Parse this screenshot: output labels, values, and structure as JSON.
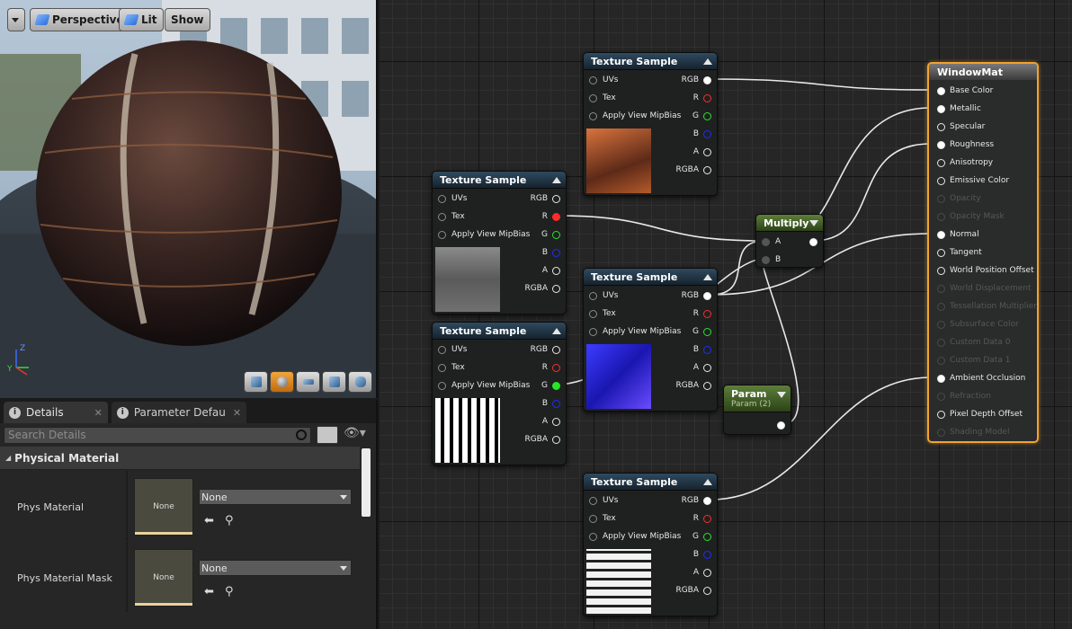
{
  "viewport": {
    "buttons": {
      "perspective": "Perspective",
      "lit": "Lit",
      "show": "Show"
    },
    "axis": {
      "x": "Y",
      "z": "Z"
    },
    "preview_tools": [
      "cylinder-icon",
      "sphere-icon",
      "plane-icon",
      "cube-icon",
      "teapot-icon"
    ]
  },
  "details": {
    "tabs": [
      {
        "label": "Details",
        "active": true
      },
      {
        "label": "Parameter Defaults",
        "active": false
      }
    ],
    "search_placeholder": "Search Details",
    "section": "Physical Material",
    "props": [
      {
        "label": "Phys Material",
        "thumb": "None",
        "value": "None"
      },
      {
        "label": "Phys Material Mask",
        "thumb": "None",
        "value": "None"
      }
    ]
  },
  "graph": {
    "nodes": {
      "ts1": {
        "title": "Texture Sample",
        "inputs": [
          "UVs",
          "Tex",
          "Apply View MipBias"
        ],
        "outputs": [
          "RGB",
          "R",
          "G",
          "B",
          "A",
          "RGBA"
        ]
      },
      "ts2": {
        "title": "Texture Sample",
        "inputs": [
          "UVs",
          "Tex",
          "Apply View MipBias"
        ],
        "outputs": [
          "RGB",
          "R",
          "G",
          "B",
          "A",
          "RGBA"
        ]
      },
      "ts3": {
        "title": "Texture Sample",
        "inputs": [
          "UVs",
          "Tex",
          "Apply View MipBias"
        ],
        "outputs": [
          "RGB",
          "R",
          "G",
          "B",
          "A",
          "RGBA"
        ]
      },
      "ts4": {
        "title": "Texture Sample",
        "inputs": [
          "UVs",
          "Tex",
          "Apply View MipBias"
        ],
        "outputs": [
          "RGB",
          "R",
          "G",
          "B",
          "A",
          "RGBA"
        ]
      },
      "ts5": {
        "title": "Texture Sample",
        "inputs": [
          "UVs",
          "Tex",
          "Apply View MipBias"
        ],
        "outputs": [
          "RGB",
          "R",
          "G",
          "B",
          "A",
          "RGBA"
        ]
      },
      "multiply": {
        "title": "Multiply",
        "inputs": [
          "A",
          "B"
        ]
      },
      "param": {
        "title": "Param",
        "subtitle": "Param (2)"
      }
    },
    "material": {
      "title": "WindowMat",
      "inputs": [
        {
          "label": "Base Color",
          "enabled": true
        },
        {
          "label": "Metallic",
          "enabled": true
        },
        {
          "label": "Specular",
          "enabled": true
        },
        {
          "label": "Roughness",
          "enabled": true
        },
        {
          "label": "Anisotropy",
          "enabled": true
        },
        {
          "label": "Emissive Color",
          "enabled": true
        },
        {
          "label": "Opacity",
          "enabled": false
        },
        {
          "label": "Opacity Mask",
          "enabled": false
        },
        {
          "label": "Normal",
          "enabled": true
        },
        {
          "label": "Tangent",
          "enabled": true
        },
        {
          "label": "World Position Offset",
          "enabled": true
        },
        {
          "label": "World Displacement",
          "enabled": false
        },
        {
          "label": "Tessellation Multiplier",
          "enabled": false
        },
        {
          "label": "Subsurface Color",
          "enabled": false
        },
        {
          "label": "Custom Data 0",
          "enabled": false
        },
        {
          "label": "Custom Data 1",
          "enabled": false
        },
        {
          "label": "Ambient Occlusion",
          "enabled": true
        },
        {
          "label": "Refraction",
          "enabled": false
        },
        {
          "label": "Pixel Depth Offset",
          "enabled": true
        },
        {
          "label": "Shading Model",
          "enabled": false
        }
      ]
    }
  },
  "colors": {
    "accent": "#f2a230",
    "pin_red": "#ff2a2a",
    "pin_green": "#27e627",
    "pin_blue": "#1d2cff"
  }
}
